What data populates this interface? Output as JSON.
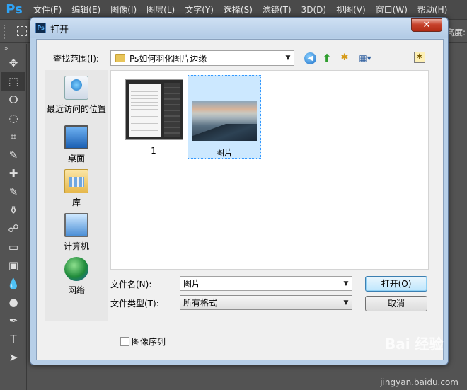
{
  "app": {
    "logo": "Ps",
    "menu": [
      "文件(F)",
      "编辑(E)",
      "图像(I)",
      "图层(L)",
      "文字(Y)",
      "选择(S)",
      "滤镜(T)",
      "3D(D)",
      "视图(V)",
      "窗口(W)",
      "帮助(H)"
    ],
    "options_height_label": "高度:"
  },
  "toolbox": {
    "collapse": "»",
    "tools": [
      "✥",
      "⬚",
      "ⵔ",
      "◌",
      "⌗",
      "✎",
      "✚",
      "✎",
      "⚱",
      "☍",
      "▭",
      "▣",
      "💧",
      "●",
      "✒",
      "T",
      "➤"
    ]
  },
  "dialog": {
    "icon_text": "Ps",
    "title": "打开",
    "close": "✕",
    "lookin_label": "查找范围(I):",
    "lookin_value": "Ps如何羽化图片边缘",
    "nav": {
      "back": "◀",
      "up": "⬆",
      "new_folder": "✱",
      "view": "▦▾",
      "extra": "✱"
    },
    "places": [
      {
        "name": "recent",
        "label": "最近访问的位置"
      },
      {
        "name": "desktop",
        "label": "桌面"
      },
      {
        "name": "library",
        "label": "库"
      },
      {
        "name": "computer",
        "label": "计算机"
      },
      {
        "name": "network",
        "label": "网络"
      }
    ],
    "files": [
      {
        "name": "1"
      },
      {
        "name": "图片"
      }
    ],
    "filename_label": "文件名(N):",
    "filename_value": "图片",
    "filetype_label": "文件类型(T):",
    "filetype_value": "所有格式",
    "open_button": "打开(O)",
    "cancel_button": "取消",
    "image_sequence": "图像序列"
  },
  "watermark": {
    "logo": "Bai 经验",
    "url": "jingyan.baidu.com"
  }
}
